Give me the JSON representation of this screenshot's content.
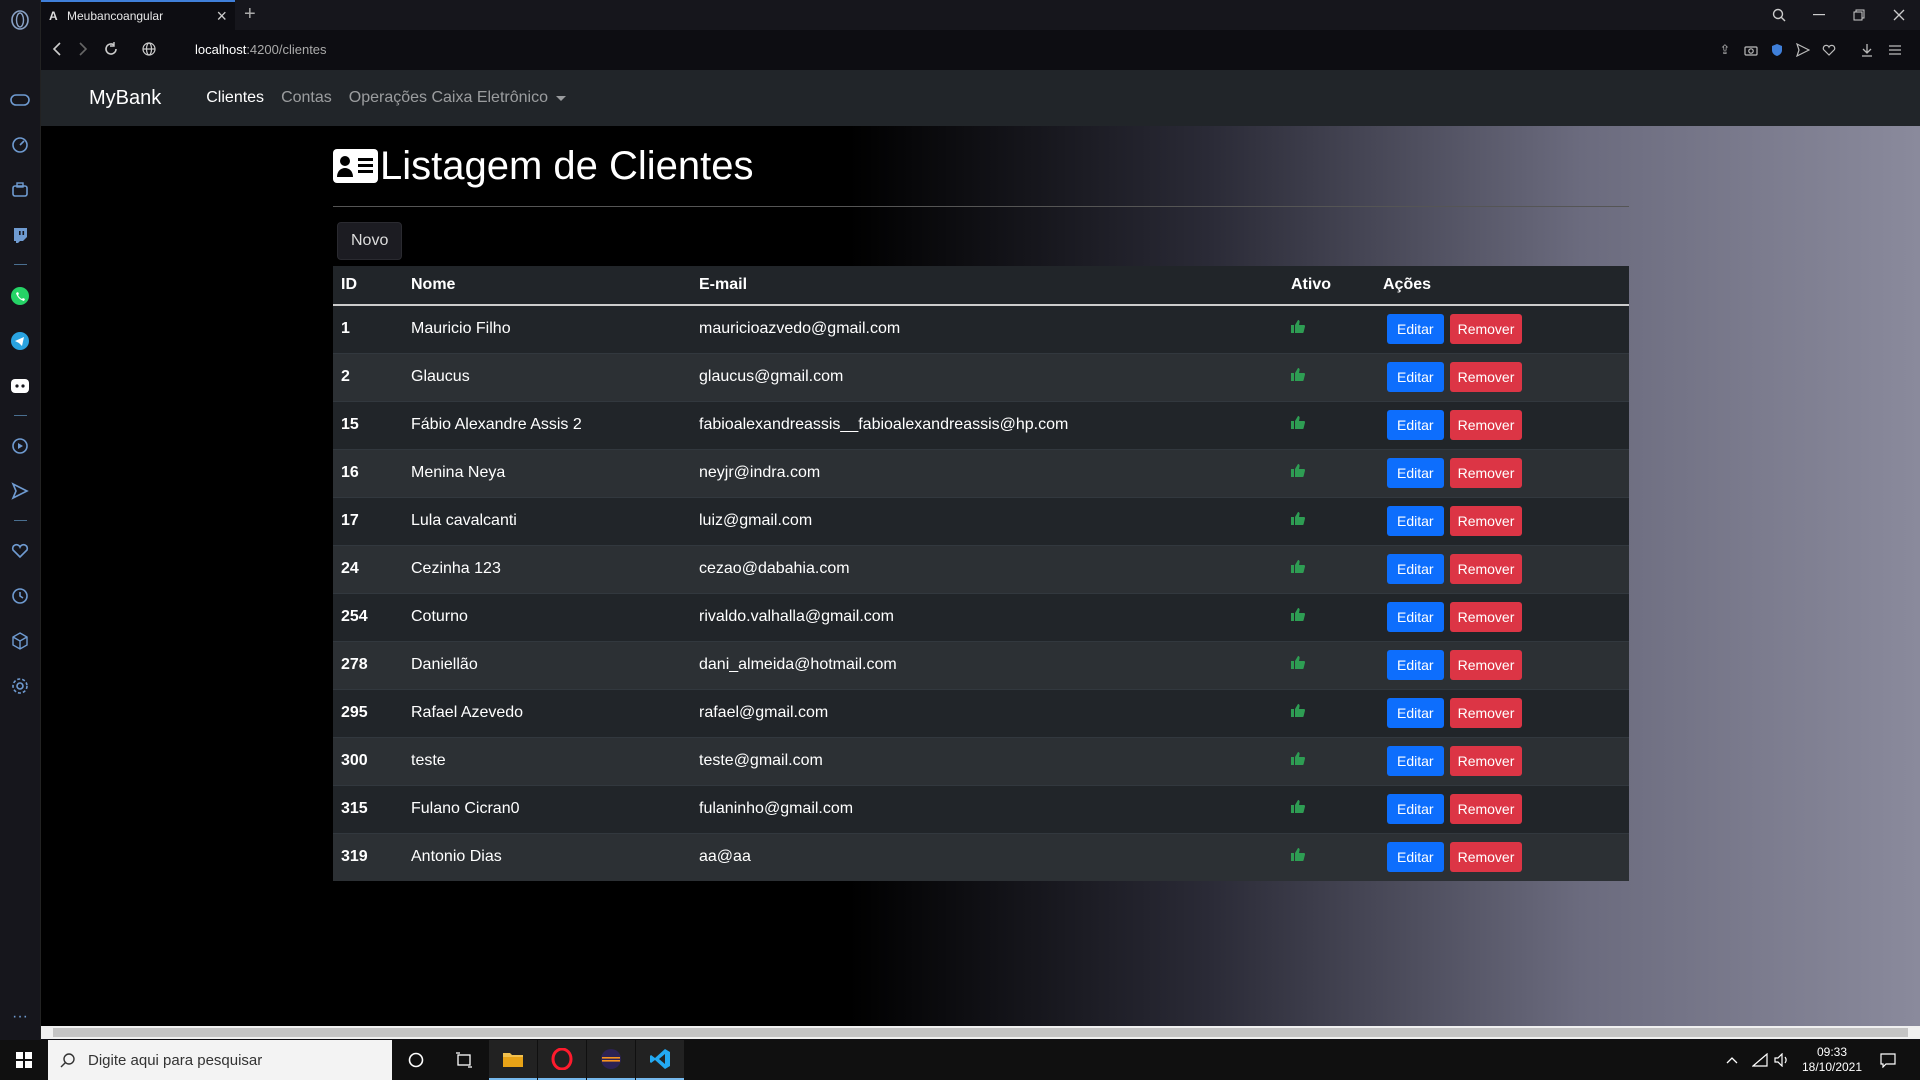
{
  "browser": {
    "tab_title": "Meubancoangular",
    "url_host": "localhost",
    "url_path": ":4200/clientes"
  },
  "navbar": {
    "brand": "MyBank",
    "links": [
      "Clientes",
      "Contas",
      "Operações Caixa Eletrônico"
    ]
  },
  "page": {
    "title": "Listagem de Clientes",
    "new_button": "Novo"
  },
  "table": {
    "headers": [
      "ID",
      "Nome",
      "E-mail",
      "Ativo",
      "Ações"
    ],
    "edit_label": "Editar",
    "remove_label": "Remover",
    "rows": [
      {
        "id": "1",
        "nome": "Mauricio Filho",
        "email": "mauricioazvedo@gmail.com"
      },
      {
        "id": "2",
        "nome": "Glaucus",
        "email": "glaucus@gmail.com"
      },
      {
        "id": "15",
        "nome": "Fábio Alexandre Assis 2",
        "email": "fabioalexandreassis__fabioalexandreassis@hp.com"
      },
      {
        "id": "16",
        "nome": "Menina Neya",
        "email": "neyjr@indra.com"
      },
      {
        "id": "17",
        "nome": "Lula cavalcanti",
        "email": "luiz@gmail.com"
      },
      {
        "id": "24",
        "nome": "Cezinha 123",
        "email": "cezao@dabahia.com"
      },
      {
        "id": "254",
        "nome": "Coturno",
        "email": "rivaldo.valhalla@gmail.com"
      },
      {
        "id": "278",
        "nome": "Daniellão",
        "email": "dani_almeida@hotmail.com"
      },
      {
        "id": "295",
        "nome": "Rafael Azevedo",
        "email": "rafael@gmail.com"
      },
      {
        "id": "300",
        "nome": "teste",
        "email": "teste@gmail.com"
      },
      {
        "id": "315",
        "nome": "Fulano Cicran0",
        "email": "fulaninho@gmail.com"
      },
      {
        "id": "319",
        "nome": "Antonio Dias",
        "email": "aa@aa"
      }
    ]
  },
  "taskbar": {
    "search_placeholder": "Digite aqui para pesquisar",
    "time": "09:33",
    "date": "18/10/2021"
  },
  "colors": {
    "primary": "#0d6efd",
    "danger": "#dc3545",
    "success": "#2e9d53",
    "navbar": "#212529"
  }
}
